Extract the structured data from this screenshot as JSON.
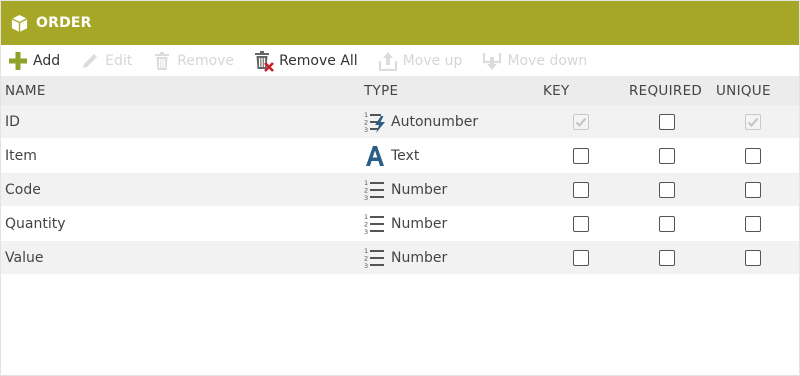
{
  "header": {
    "title": "ORDER",
    "background": "#a6a727"
  },
  "toolbar": {
    "add_label": "Add",
    "edit_label": "Edit",
    "remove_label": "Remove",
    "remove_all_label": "Remove All",
    "move_up_label": "Move up",
    "move_down_label": "Move down"
  },
  "columns": {
    "name": "NAME",
    "type": "TYPE",
    "key": "KEY",
    "required": "REQUIRED",
    "unique": "UNIQUE"
  },
  "rows": [
    {
      "name": "ID",
      "type": "Autonumber",
      "type_icon": "autonumber-icon",
      "key": true,
      "key_disabled": true,
      "required": false,
      "unique": true,
      "unique_disabled": true
    },
    {
      "name": "Item",
      "type": "Text",
      "type_icon": "text-type-icon",
      "key": false,
      "required": false,
      "unique": false
    },
    {
      "name": "Code",
      "type": "Number",
      "type_icon": "number-type-icon",
      "key": false,
      "required": false,
      "unique": false
    },
    {
      "name": "Quantity",
      "type": "Number",
      "type_icon": "number-type-icon",
      "key": false,
      "required": false,
      "unique": false
    },
    {
      "name": "Value",
      "type": "Number",
      "type_icon": "number-type-icon",
      "key": false,
      "required": false,
      "unique": false
    }
  ]
}
